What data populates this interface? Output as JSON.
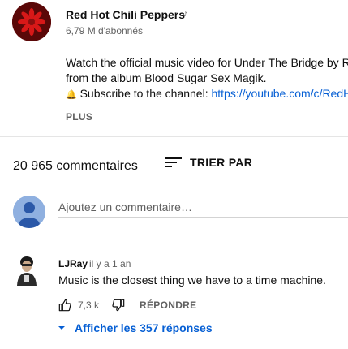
{
  "channel": {
    "name": "Red Hot Chili Peppers",
    "subscribers": "6,79 M d'abonnés",
    "icon": "music-note-icon"
  },
  "description": {
    "line1": "Watch the official music video for Under The Bridge by Red Hot Chili Peppers",
    "line2": "from the album Blood Sugar Sex Magik.",
    "line3_text": "Subscribe to the channel: ",
    "line3_link": "https://youtube.com/c/RedHotChiliPeppers",
    "more_label": "PLUS"
  },
  "comments_header": {
    "count_label": "20 965 commentaires",
    "sort_label": "TRIER PAR"
  },
  "add_comment": {
    "placeholder": "Ajoutez un commentaire…"
  },
  "comments": [
    {
      "author": "LJRay",
      "time": "il y a 1 an",
      "text": "Music is the closest thing we have to a time machine.",
      "likes": "7,3 k",
      "reply_label": "RÉPONDRE",
      "replies_label": "Afficher les 357 réponses"
    }
  ],
  "colors": {
    "link": "#065fd4",
    "secondary_text": "#606060",
    "divider": "#e5e5e5"
  }
}
